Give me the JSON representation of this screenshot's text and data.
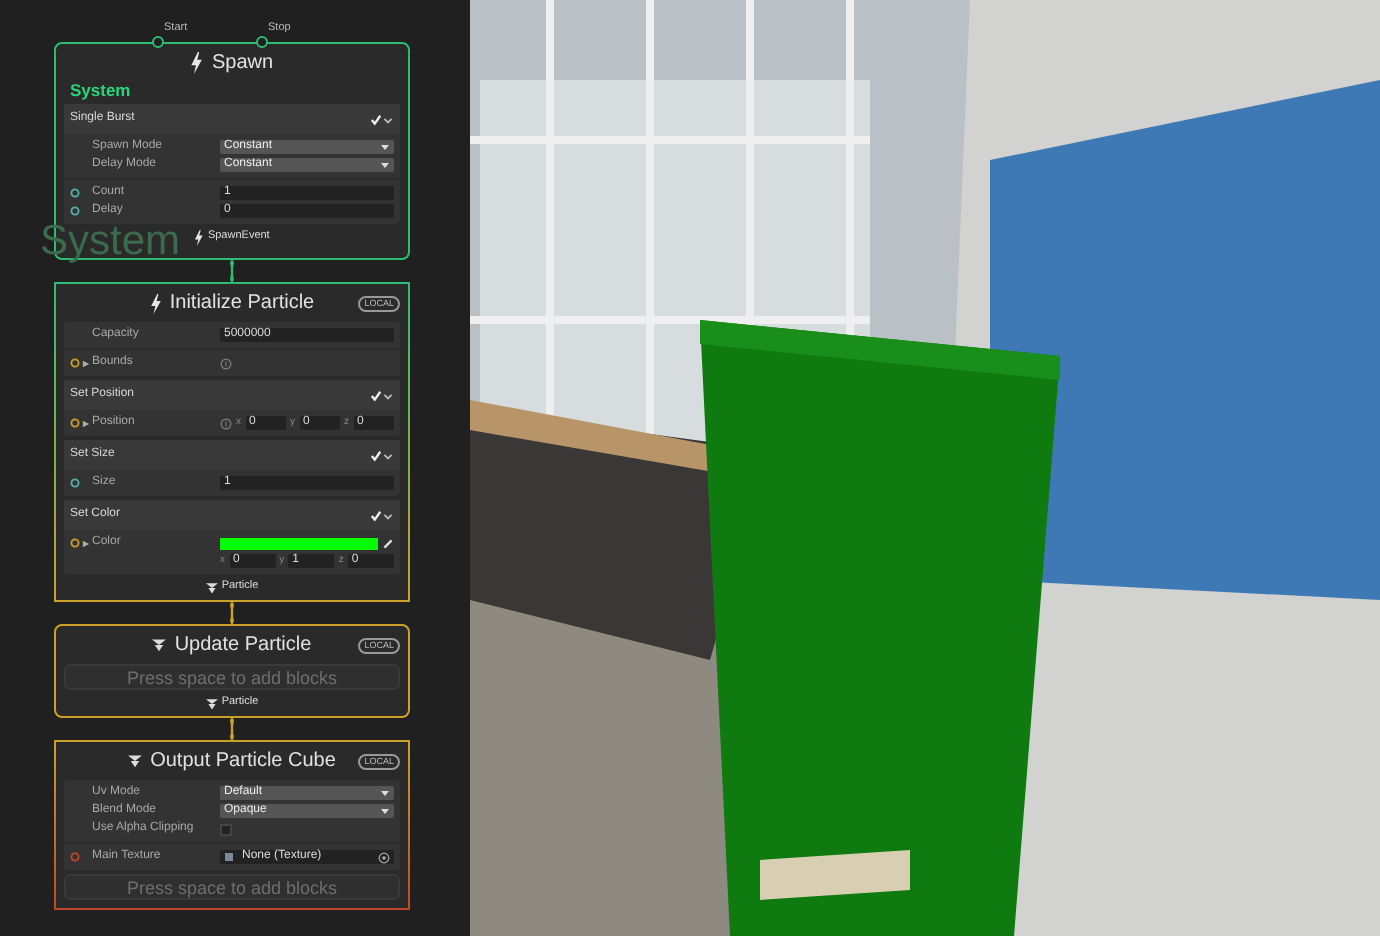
{
  "group_title": "System",
  "spawn": {
    "ports": [
      "Start",
      "Stop"
    ],
    "title": "Spawn",
    "system_name": "System",
    "block": {
      "title": "Single Burst",
      "enabled": true,
      "rows": [
        {
          "kind": "dropdown",
          "label": "Spawn Mode",
          "value": "Constant",
          "port": false
        },
        {
          "kind": "dropdown",
          "label": "Delay Mode",
          "value": "Constant",
          "port": false
        },
        {
          "kind": "text",
          "label": "Count",
          "value": "1",
          "port": true
        },
        {
          "kind": "text",
          "label": "Delay",
          "value": "0",
          "port": true
        }
      ]
    },
    "output": "SpawnEvent"
  },
  "contexts": [
    {
      "kind": "initialize",
      "title": "Initialize Particle",
      "badge": "LOCAL",
      "rows": [
        {
          "kind": "text",
          "label": "Capacity",
          "value": "5000000",
          "port": false
        },
        {
          "kind": "info",
          "label": "Bounds",
          "port": true,
          "expandable": true
        }
      ],
      "blocks": [
        {
          "title": "Set Position",
          "enabled": true,
          "rows": [
            {
              "kind": "vector",
              "label": "Position",
              "port": true,
              "expandable": true,
              "info": true,
              "values": [
                {
                  "axis": "x",
                  "value": "0"
                },
                {
                  "axis": "y",
                  "value": "0"
                },
                {
                  "axis": "z",
                  "value": "0"
                }
              ]
            }
          ]
        },
        {
          "title": "Set Size",
          "enabled": true,
          "rows": [
            {
              "kind": "text",
              "label": "Size",
              "value": "1",
              "port": true
            }
          ]
        },
        {
          "title": "Set Color",
          "enabled": true,
          "rows": [
            {
              "kind": "color",
              "label": "Color",
              "port": true,
              "expandable": true,
              "color": "#00ff00",
              "values": [
                {
                  "axis": "x",
                  "value": "0"
                },
                {
                  "axis": "y",
                  "value": "1"
                },
                {
                  "axis": "z",
                  "value": "0"
                }
              ]
            }
          ]
        }
      ],
      "output": "Particle"
    },
    {
      "kind": "update",
      "title": "Update Particle",
      "badge": "LOCAL",
      "hint": "Press space to add blocks",
      "output": "Particle"
    },
    {
      "kind": "output",
      "title": "Output Particle Cube",
      "badge": "LOCAL",
      "rows": [
        {
          "kind": "dropdown",
          "label": "Uv Mode",
          "value": "Default",
          "port": false
        },
        {
          "kind": "dropdown",
          "label": "Blend Mode",
          "value": "Opaque",
          "port": false
        },
        {
          "kind": "checkbox",
          "label": "Use Alpha Clipping",
          "checked": false,
          "port": false
        },
        {
          "kind": "object",
          "label": "Main Texture",
          "value": "None (Texture)",
          "port": true
        }
      ],
      "hint": "Press space to add blocks"
    }
  ]
}
